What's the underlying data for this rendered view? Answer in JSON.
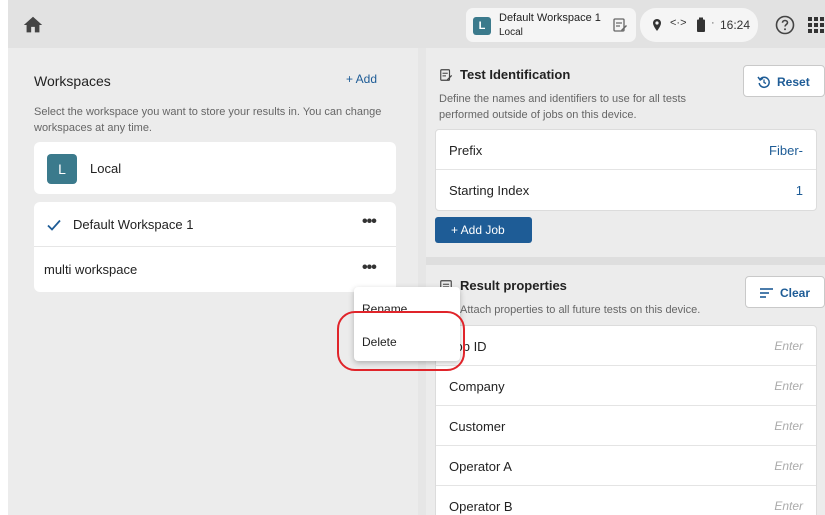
{
  "topbar": {
    "home_icon": "home-icon",
    "workspace_pill": {
      "avatar": "L",
      "name": "Default Workspace 1",
      "sub": "Local",
      "edit_icon": "edit-note-icon"
    },
    "status": {
      "location_icon": "location-pin-icon",
      "network": "<·>",
      "battery_icon": "battery-icon",
      "separator": "·",
      "time": "16:24"
    },
    "help_icon": "help-circle-icon",
    "apps_icon": "apps-grid-icon"
  },
  "workspaces": {
    "title": "Workspaces",
    "add_label": "+ Add",
    "description": "Select the workspace you want to store your results in. You can change workspaces at any time.",
    "local": {
      "avatar": "L",
      "name": "Local"
    },
    "items": [
      {
        "name": "Default Workspace 1",
        "selected": true,
        "more": "•••"
      },
      {
        "name": "multi workspace",
        "selected": false,
        "more": "•••"
      }
    ]
  },
  "context_menu": {
    "items": [
      "Rename",
      "Delete"
    ]
  },
  "test_identification": {
    "title": "Test Identification",
    "reset_label": "Reset",
    "description": "Define the names and identifiers to use for all tests performed outside of jobs on this device.",
    "fields": [
      {
        "label": "Prefix",
        "value": "Fiber-"
      },
      {
        "label": "Starting Index",
        "value": "1"
      }
    ],
    "add_job_label": "+  Add Job"
  },
  "result_properties": {
    "title": "Result properties",
    "clear_label": "Clear",
    "description": "Attach properties to all future tests on this device.",
    "placeholder": "Enter",
    "fields": [
      "Job ID",
      "Company",
      "Customer",
      "Operator A",
      "Operator B"
    ]
  },
  "colors": {
    "accent": "#1e5c96",
    "avatar": "#3b7a8c",
    "highlight": "#e0242a"
  }
}
